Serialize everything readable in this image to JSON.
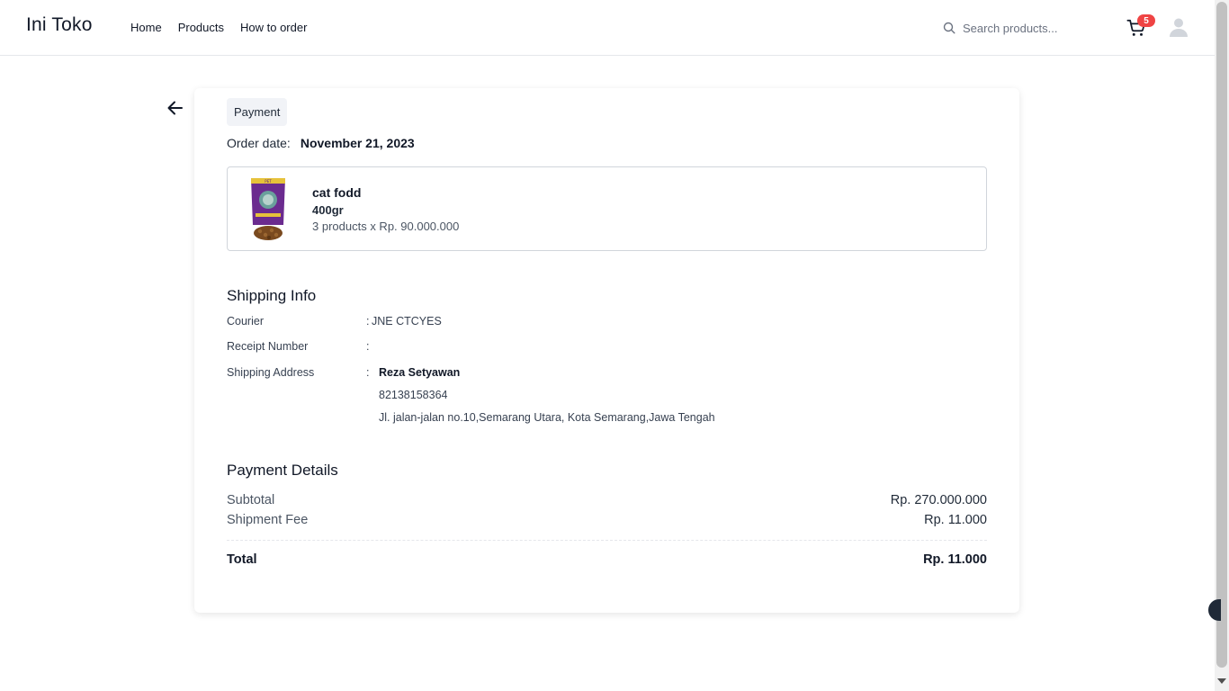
{
  "header": {
    "logo": "Ini Toko",
    "nav": [
      "Home",
      "Products",
      "How to order"
    ],
    "search_placeholder": "Search products...",
    "cart_count": "5",
    "icons": {
      "search": "search-icon",
      "cart": "cart-icon",
      "avatar": "user-avatar-icon"
    }
  },
  "order": {
    "status": "Payment",
    "date_label": "Order date:",
    "date_value": "November 21, 2023",
    "product": {
      "name": "cat fodd",
      "variant": "400gr",
      "quantity_text": "3 products x Rp. 90.000.000"
    }
  },
  "shipping": {
    "title": "Shipping Info",
    "courier_label": "Courier",
    "courier_value": "JNE CTCYES",
    "receipt_label": "Receipt Number",
    "receipt_value": "",
    "address_label": "Shipping Address",
    "recipient_name": "Reza Setyawan",
    "phone": "82138158364",
    "address": "Jl. jalan-jalan no.10,Semarang Utara, Kota Semarang,Jawa Tengah"
  },
  "payment": {
    "title": "Payment Details",
    "subtotal_label": "Subtotal",
    "subtotal_value": "Rp. 270.000.000",
    "shipment_label": "Shipment Fee",
    "shipment_value": "Rp. 11.000",
    "total_label": "Total",
    "total_value": "Rp. 11.000"
  },
  "colors": {
    "badge": "#ef4444",
    "border": "#e5e7eb",
    "chip_bg": "#f1f3f7"
  }
}
